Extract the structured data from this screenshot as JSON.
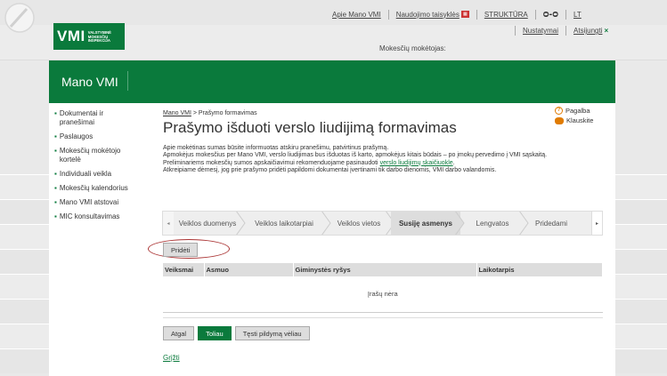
{
  "header": {
    "logo_big": "VMI",
    "logo_small": [
      "VALSTYBINĖ",
      "MOKESČIŲ",
      "INSPEKCIJA"
    ],
    "links": [
      {
        "label": "Apie Mano VMI"
      },
      {
        "label": "Naudojimo taisyklės"
      },
      {
        "label": "STRUKTŪRA"
      },
      {
        "label": "LT"
      }
    ],
    "settings_label": "Nustatymai",
    "logout_label": "Atsijungti",
    "payer_label": "Mokesčių mokėtojas:"
  },
  "banner": {
    "title": "Mano VMI"
  },
  "sidebar": {
    "items": [
      {
        "label": "Dokumentai ir pranešimai"
      },
      {
        "label": "Paslaugos"
      },
      {
        "label": "Mokesčių mokėtojo kortelė"
      },
      {
        "label": "Individuali veikla"
      },
      {
        "label": "Mokesčių kalendorius"
      },
      {
        "label": "Mano VMI atstovai"
      },
      {
        "label": "MIC konsultavimas"
      }
    ]
  },
  "breadcrumb": {
    "root": "Mano VMI",
    "separator": " > ",
    "current": "Prašymo formavimas"
  },
  "page_title": "Prašymo išduoti verslo liudijimą formavimas",
  "help": {
    "pagalba": "Pagalba",
    "klauskite": "Klauskite"
  },
  "intro": {
    "line1": "Apie mokėtinas sumas būsite informuotas atskiru pranešimu, patvirtinus prašymą.",
    "line2": "Apmokėjus mokesčius per Mano VMI, verslo liudijimas bus išduotas iš karto, apmokėjus kitais būdais – po įmokų pervedimo į VMI sąskaitą.",
    "line3_before": "Preliminariems mokesčių sumos apskaičiavimui rekomenduojame pasinaudoti ",
    "line3_link": "verslo liudijimų skaičiuokle",
    "line3_after": ".",
    "line4": "Atkreipiame dėmesį, jog prie prašymo pridėti papildomi dokumentai įvertinami tik darbo dienomis, VMI darbo valandomis."
  },
  "wizard": {
    "steps": [
      {
        "label": "Veiklos duomenys",
        "active": false
      },
      {
        "label": "Veiklos laikotarpiai",
        "active": false
      },
      {
        "label": "Veiklos vietos",
        "active": false
      },
      {
        "label": "Susiję asmenys",
        "active": true
      },
      {
        "label": "Lengvatos",
        "active": false
      },
      {
        "label": "Pridedami",
        "active": false
      }
    ]
  },
  "add_button": "Pridėti",
  "table": {
    "columns": [
      "Veiksmai",
      "Asmuo",
      "Giminystės ryšys",
      "Laikotarpis"
    ],
    "empty_text": "Įrašų nėra"
  },
  "buttons": {
    "back": "Atgal",
    "next": "Toliau",
    "continue_later": "Tęsti pildymą vėliau"
  },
  "return_link": "Grįžti"
}
